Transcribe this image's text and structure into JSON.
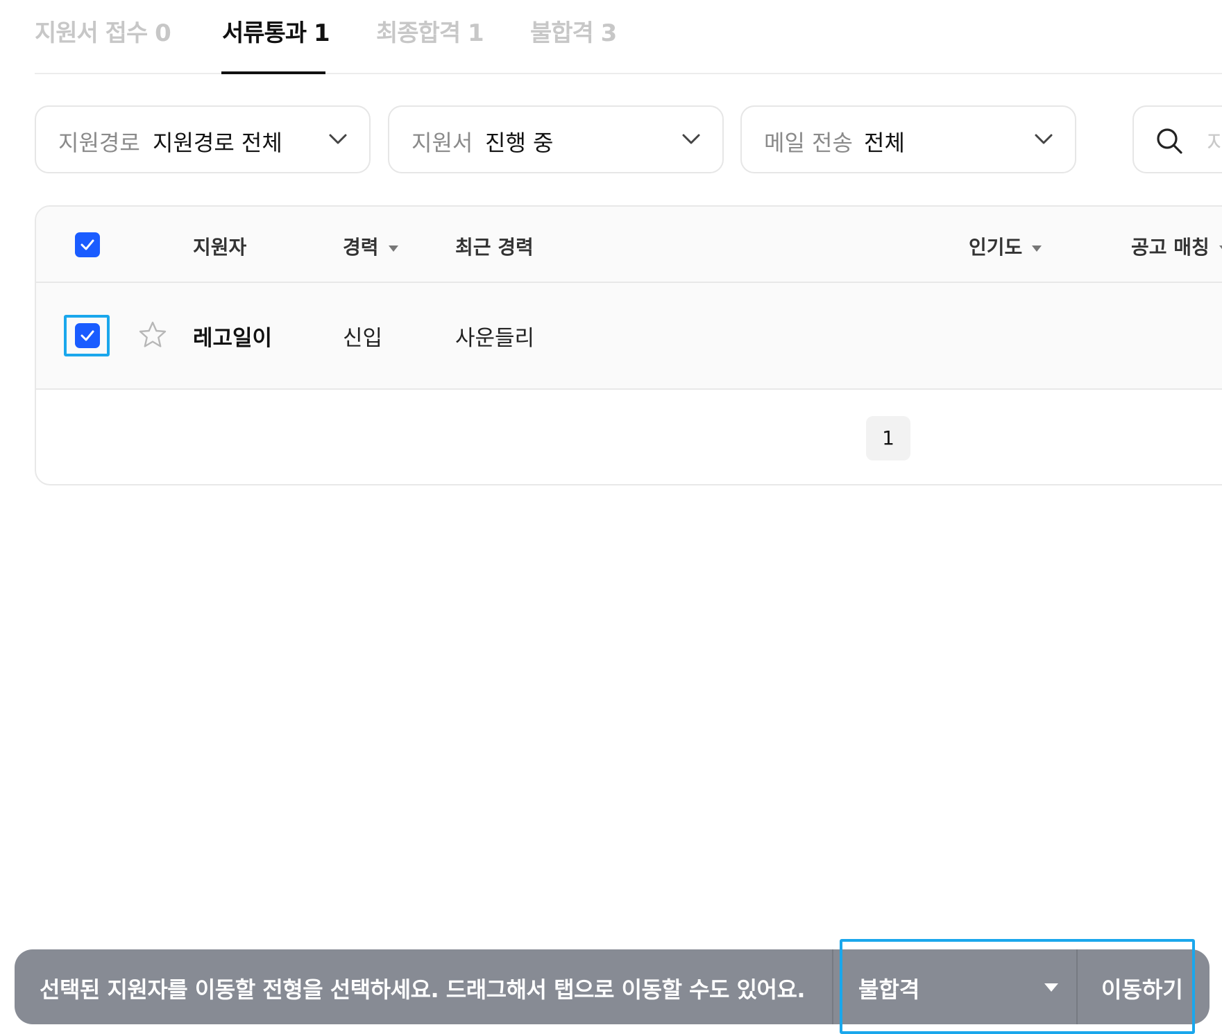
{
  "tabs": [
    {
      "label": "지원서 접수 0",
      "active": false
    },
    {
      "label": "서류통과 1",
      "active": true
    },
    {
      "label": "최종합격 1",
      "active": false
    },
    {
      "label": "불합격 3",
      "active": false
    }
  ],
  "filters": {
    "source": {
      "label": "지원경로",
      "value": "지원경로 전체"
    },
    "application": {
      "label": "지원서",
      "value": "진행 중"
    },
    "mail": {
      "label": "메일 전송",
      "value": "전체"
    }
  },
  "search": {
    "placeholder": "지"
  },
  "table": {
    "headers": {
      "applicant": "지원자",
      "career": "경력",
      "recent_career": "최근 경력",
      "popularity": "인기도",
      "job_match": "공고 매칭"
    },
    "rows": [
      {
        "name": "레고일이",
        "career": "신입",
        "recent_career": "사운들리",
        "selected": true,
        "starred": false
      }
    ],
    "header_checkbox_checked": true
  },
  "pagination": {
    "current_page": "1"
  },
  "action_bar": {
    "message": "선택된 지원자를 이동할 전형을 선택하세요. 드래그해서 탭으로 이동할 수도 있어요.",
    "stage_selected": "불합격",
    "move_label": "이동하기"
  },
  "colors": {
    "accent": "#1a5cff",
    "focus_ring": "#1aa7ec",
    "action_bar_bg": "#878b94",
    "inactive_tab": "#c7c7c7"
  }
}
